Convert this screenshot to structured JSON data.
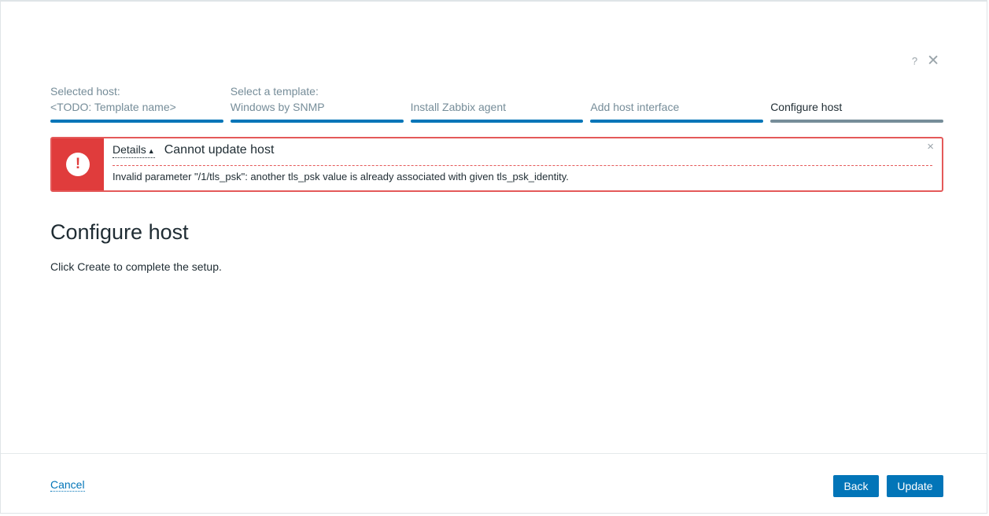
{
  "header": {
    "help_glyph": "?",
    "close_glyph": "✕"
  },
  "steps": [
    {
      "top": "Selected host:",
      "main": "<TODO: Template name>"
    },
    {
      "top": "Select a template:",
      "main": "Windows by SNMP"
    },
    {
      "top": "",
      "main": "Install Zabbix agent"
    },
    {
      "top": "",
      "main": "Add host interface"
    },
    {
      "top": "",
      "main": "Configure host"
    }
  ],
  "message": {
    "details_label": "Details",
    "details_arrow": "▲",
    "title": "Cannot update host",
    "detail": "Invalid parameter \"/1/tls_psk\": another tls_psk value is already associated with given tls_psk_identity.",
    "alert_glyph": "!",
    "close_glyph": "×"
  },
  "section": {
    "title": "Configure host",
    "description": "Click Create to complete the setup."
  },
  "footer": {
    "cancel_label": "Cancel",
    "back_label": "Back",
    "update_label": "Update"
  },
  "colors": {
    "accent": "#0275b8",
    "error": "#e03c3c",
    "step_current": "#768d99"
  }
}
